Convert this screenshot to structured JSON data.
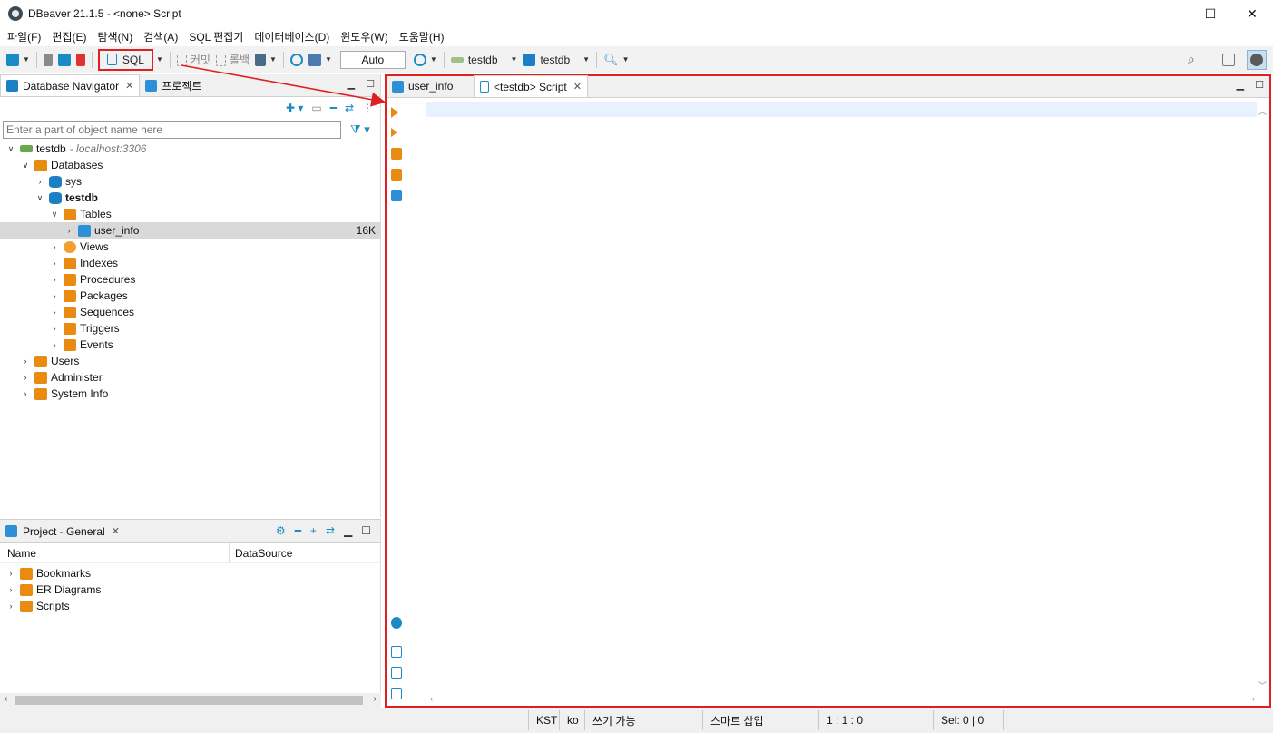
{
  "window": {
    "title": "DBeaver 21.1.5 - <none> Script",
    "minimize": "—",
    "maximize": "☐",
    "close": "✕"
  },
  "menu": [
    "파일(F)",
    "편집(E)",
    "탐색(N)",
    "검색(A)",
    "SQL 편집기",
    "데이터베이스(D)",
    "윈도우(W)",
    "도움말(H)"
  ],
  "toolbar": {
    "sql_label": "SQL",
    "commit_label": "커밋",
    "rollback_label": "롤백",
    "transaction_mode": "Auto",
    "active_datasource": "testdb",
    "active_schema": "testdb"
  },
  "navigator": {
    "tab_label": "Database Navigator",
    "project_tab_label": "프로젝트",
    "filter_placeholder": "Enter a part of object name here",
    "tree": {
      "connection": "testdb",
      "connection_host": "- localhost:3306",
      "databases": "Databases",
      "sys": "sys",
      "testdb": "testdb",
      "tables": "Tables",
      "user_info": "user_info",
      "user_info_size": "16K",
      "views": "Views",
      "indexes": "Indexes",
      "procedures": "Procedures",
      "packages": "Packages",
      "sequences": "Sequences",
      "triggers": "Triggers",
      "events": "Events",
      "users": "Users",
      "administer": "Administer",
      "system_info": "System Info"
    }
  },
  "project": {
    "title": "Project - General",
    "col_name": "Name",
    "col_datasource": "DataSource",
    "items": [
      "Bookmarks",
      "ER Diagrams",
      "Scripts"
    ]
  },
  "editor": {
    "tabs": [
      "user_info",
      "<testdb> Script"
    ]
  },
  "status": [
    "KST",
    "ko",
    "쓰기 가능",
    "스마트 삽입",
    "1 : 1 : 0",
    "Sel: 0 | 0"
  ],
  "colors": {
    "highlight": "#e02020",
    "accent": "#1a8bc4",
    "folder": "#e98b10"
  }
}
